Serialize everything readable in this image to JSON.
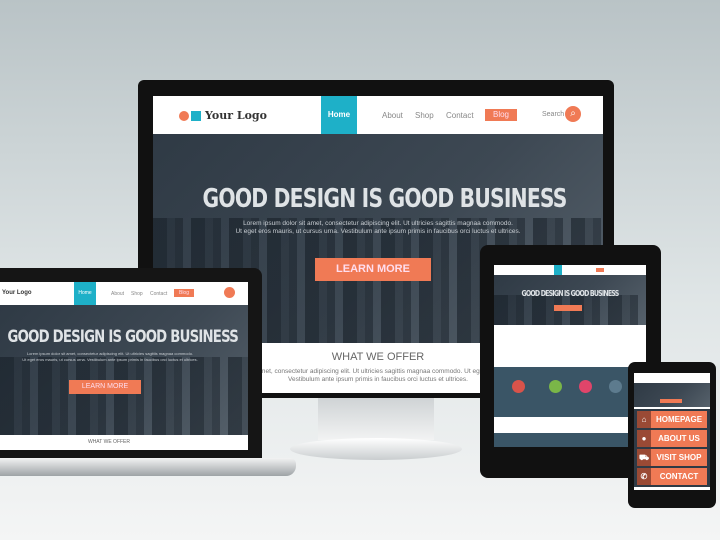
{
  "site": {
    "logo": "Your Logo",
    "nav": [
      "Home",
      "About",
      "Shop",
      "Contact",
      "Blog"
    ],
    "search": "Search",
    "headline": "GOOD DESIGN IS GOOD BUSINESS",
    "lorem1": "Lorem ipsum dolor sit amet, consectetur adipiscing elit. Ut ultricies sagittis magnaa commodo.",
    "lorem2": "Ut eget eros mauris, ut cursus urna. Vestibulum ante ipsum primis in faucibus orci luctus et ultrices.",
    "cta": "LEARN MORE",
    "offer_title": "WHAT WE OFFER",
    "offer_text1": "amet, consectetur adipiscing elit. Ut ultricies sagittis magnaa commodo. Ut eget eros",
    "offer_text2": "Vestibulum ante ipsum primis in faucibus orci luctus et ultrices."
  },
  "phone_menu": [
    {
      "label": "HOMEPAGE",
      "icon": "home-icon"
    },
    {
      "label": "ABOUT US",
      "icon": "user-icon"
    },
    {
      "label": "VISIT SHOP",
      "icon": "cart-icon"
    },
    {
      "label": "CONTACT",
      "icon": "phone-icon"
    }
  ],
  "colors": {
    "accent": "#f07a55",
    "teal": "#1eb0c8",
    "hero": "#37424d"
  }
}
